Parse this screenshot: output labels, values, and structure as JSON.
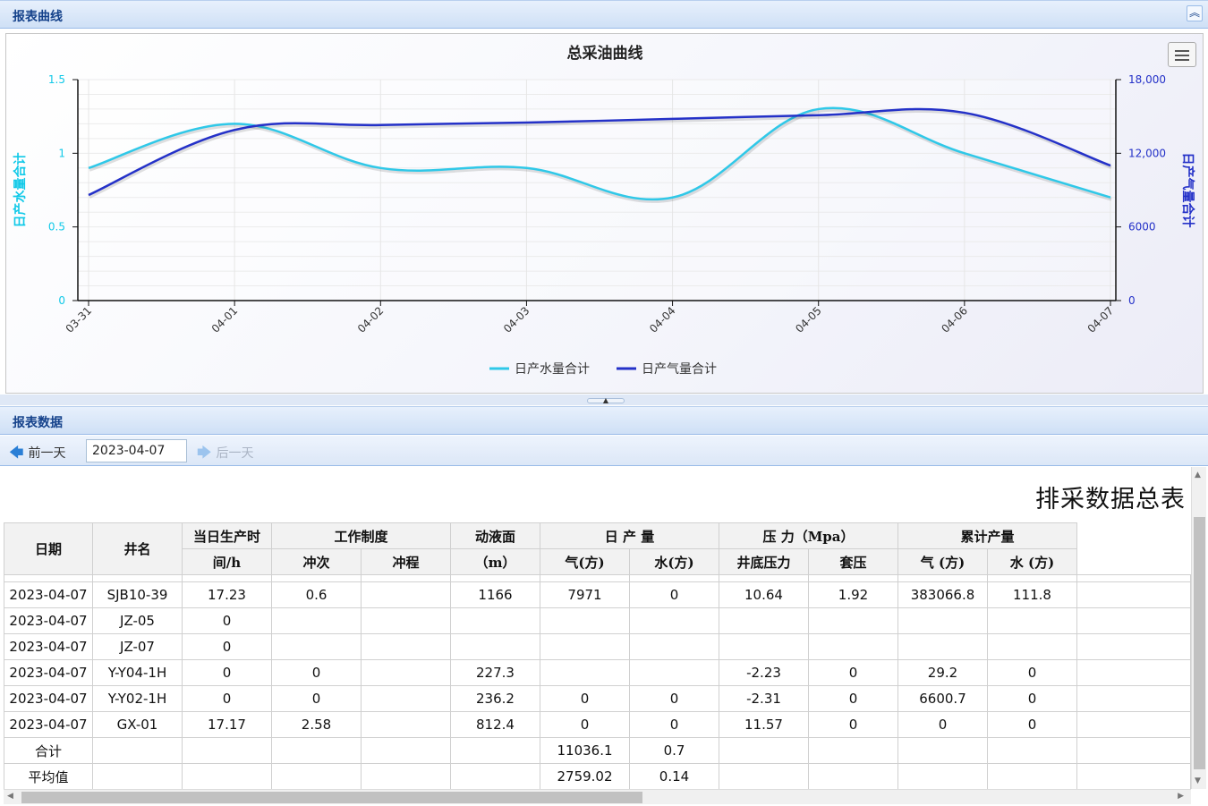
{
  "top_panel": {
    "title": "报表曲线",
    "collapse_icon": "double-chevron-up-icon"
  },
  "chart_data": {
    "type": "line",
    "title": "总采油曲线",
    "categories": [
      "03-31",
      "04-01",
      "04-02",
      "04-03",
      "04-04",
      "04-05",
      "04-06",
      "04-07"
    ],
    "series": [
      {
        "name": "日产水量合计",
        "axis": "left",
        "color": "#2fc8e8",
        "values": [
          0.9,
          1.2,
          0.9,
          0.9,
          0.7,
          1.3,
          1.0,
          0.7
        ]
      },
      {
        "name": "日产气量合计",
        "axis": "right",
        "color": "#2431c8",
        "values": [
          8600,
          13900,
          14300,
          14500,
          14800,
          15100,
          15300,
          11000
        ]
      }
    ],
    "y_left": {
      "label": "日产水量合计",
      "range": [
        0,
        1.5
      ],
      "ticks": [
        "0",
        "0.5",
        "1",
        "1.5"
      ],
      "color": "#11c9e8"
    },
    "y_right": {
      "label": "日产气量合计",
      "range": [
        0,
        18000
      ],
      "ticks": [
        "0",
        "6000",
        "12,000",
        "18,000"
      ],
      "color": "#2431c8"
    },
    "grid": true,
    "legend_position": "bottom-center"
  },
  "bottom_panel": {
    "title": "报表数据"
  },
  "toolbar": {
    "prev_label": "前一天",
    "next_label": "后一天",
    "date_value": "2023-04-07"
  },
  "report": {
    "title": "排采数据总表",
    "headers": {
      "date": "日期",
      "well": "井名",
      "hours_line1": "当日生产时",
      "hours_line2": "间/h",
      "work_system": "工作制度",
      "strokes": "冲次",
      "stroke_length": "冲程",
      "fluid_level_line1": "动液面",
      "fluid_level_line2": "（m）",
      "daily_production": "日 产 量",
      "gas": "气(方)",
      "water": "水(方)",
      "pressure": "压 力（Mpa）",
      "bottom_pressure": "井底压力",
      "casing_pressure": "套压",
      "cumulative": "累计产量",
      "cum_gas": "气 (方)",
      "cum_water": "水 (方)"
    },
    "rows": [
      [
        "2023-04-07",
        "SJB10-39",
        "17.23",
        "0.6",
        "",
        "1166",
        "7971",
        "0",
        "10.64",
        "1.92",
        "383066.8",
        "111.8",
        ""
      ],
      [
        "2023-04-07",
        "JZ-05",
        "0",
        "",
        "",
        "",
        "",
        "",
        "",
        "",
        "",
        "",
        ""
      ],
      [
        "2023-04-07",
        "JZ-07",
        "0",
        "",
        "",
        "",
        "",
        "",
        "",
        "",
        "",
        "",
        ""
      ],
      [
        "2023-04-07",
        "Y-Y04-1H",
        "0",
        "0",
        "",
        "227.3",
        "",
        "",
        "-2.23",
        "0",
        "29.2",
        "0",
        ""
      ],
      [
        "2023-04-07",
        "Y-Y02-1H",
        "0",
        "0",
        "",
        "236.2",
        "0",
        "0",
        "-2.31",
        "0",
        "6600.7",
        "0",
        ""
      ],
      [
        "2023-04-07",
        "GX-01",
        "17.17",
        "2.58",
        "",
        "812.4",
        "0",
        "0",
        "11.57",
        "0",
        "0",
        "0",
        ""
      ],
      [
        "合计",
        "",
        "",
        "",
        "",
        "",
        "11036.1",
        "0.7",
        "",
        "",
        "",
        "",
        ""
      ],
      [
        "平均值",
        "",
        "",
        "",
        "",
        "",
        "2759.02",
        "0.14",
        "",
        "",
        "",
        "",
        ""
      ]
    ]
  }
}
